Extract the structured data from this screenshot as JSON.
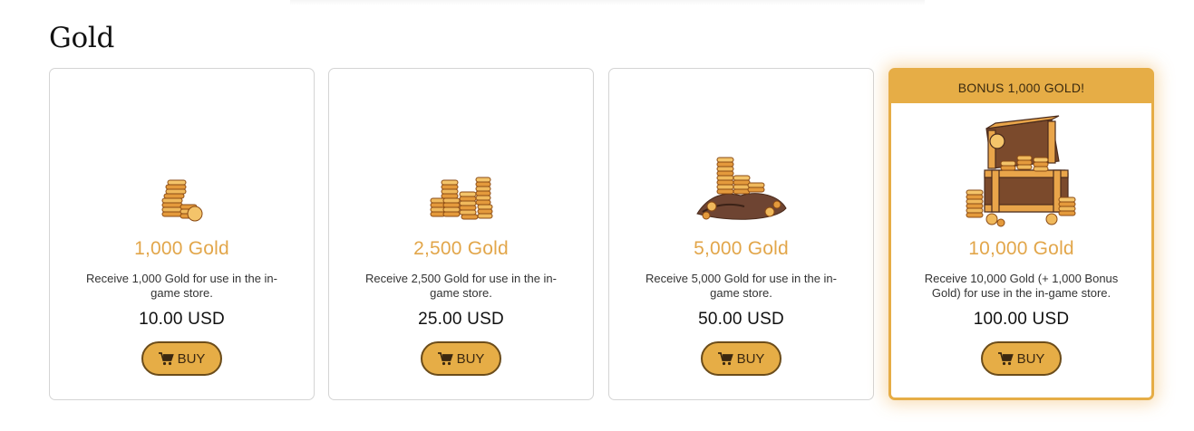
{
  "page": {
    "title": "Gold"
  },
  "colors": {
    "accent": "#e6ad46",
    "amount_text": "#e2a64a",
    "button_border": "#6b4c1a"
  },
  "cards": [
    {
      "amount": "1,000 Gold",
      "description": "Receive 1,000 Gold for use in the in-game store.",
      "price": "10.00 USD",
      "buy_label": "BUY",
      "icon": "small-coin-stack-icon"
    },
    {
      "amount": "2,500 Gold",
      "description": "Receive 2,500 Gold for use in the in-game store.",
      "price": "25.00 USD",
      "buy_label": "BUY",
      "icon": "coin-piles-icon"
    },
    {
      "amount": "5,000 Gold",
      "description": "Receive 5,000 Gold for use in the in-game store.",
      "price": "50.00 USD",
      "buy_label": "BUY",
      "icon": "gold-sack-icon"
    },
    {
      "ribbon": "BONUS 1,000 GOLD!",
      "amount": "10,000 Gold",
      "description": "Receive 10,000 Gold (+ 1,000 Bonus Gold) for use in the in-game store.",
      "price": "100.00 USD",
      "buy_label": "BUY",
      "icon": "treasure-chest-icon"
    }
  ]
}
